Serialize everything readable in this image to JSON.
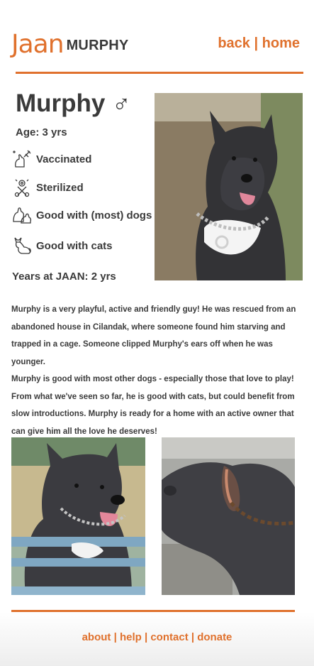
{
  "header": {
    "logo_mark": "Jaan",
    "logo_text": "MURPHY",
    "nav": {
      "back": "back",
      "separator": "|",
      "home": "home"
    }
  },
  "profile": {
    "name": "Murphy",
    "gender_symbol": "♂",
    "age": "Age: 3 yrs",
    "traits": [
      {
        "label": "Vaccinated",
        "icon": "vaccine-dog-icon"
      },
      {
        "label": "Sterilized",
        "icon": "sterilized-icon"
      },
      {
        "label": "Good with (most) dogs",
        "icon": "dogs-icon"
      },
      {
        "label": "Good with cats",
        "icon": "cat-icon"
      }
    ],
    "years_at_jaan": "Years at JAAN: 2 yrs"
  },
  "description": {
    "paragraph1": "Murphy is a very playful, active and friendly guy! He was rescued from an abandoned house in Cilandak, where someone found him starving and trapped in a cage. Someone clipped Murphy's ears off when he was younger.",
    "paragraph2": "Murphy is good with most other dogs - especially those that love to play! From what we've seen so far, he is good with cats, but could benefit from slow introductions. Murphy is ready for a home with an active owner that can give him all the love he deserves!"
  },
  "footer": {
    "about": "about",
    "help": "help",
    "contact": "contact",
    "donate": "donate",
    "separator": "|"
  },
  "colors": {
    "accent": "#e0712d",
    "text": "#3a3a3a"
  }
}
